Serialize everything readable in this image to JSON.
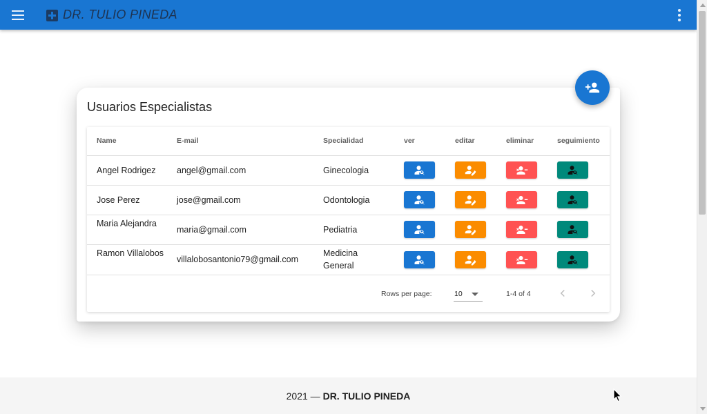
{
  "app": {
    "brand": "DR. TULIO PINEDA"
  },
  "card": {
    "title": "Usuarios Especialistas"
  },
  "table": {
    "headers": {
      "name": "Name",
      "email": "E-mail",
      "specialty": "Specialidad",
      "view": "ver",
      "edit": "editar",
      "delete": "eliminar",
      "followup": "seguimiento"
    },
    "rows": [
      {
        "name": "Angel Rodrigez",
        "email": "angel@gmail.com",
        "specialty": "Ginecologia"
      },
      {
        "name": "Jose Perez",
        "email": "jose@gmail.com",
        "specialty": "Odontologia"
      },
      {
        "name": "Maria Alejandra",
        "email": "maria@gmail.com",
        "specialty": "Pediatria"
      },
      {
        "name": "Ramon Villalobos",
        "email": "villalobosantonio79@gmail.com",
        "specialty": "Medicina General"
      }
    ]
  },
  "pagination": {
    "rows_per_page_label": "Rows per page:",
    "rows_per_page_value": "10",
    "range": "1-4 of 4"
  },
  "footer": {
    "year": "2021 —",
    "name": "DR. TULIO PINEDA"
  },
  "icons": {
    "menu": "menu-icon",
    "brand": "medical-cross-icon",
    "more": "more-vert-icon",
    "add_user": "person-add-icon",
    "view": "person-search-icon",
    "edit": "person-edit-icon",
    "delete": "person-remove-icon",
    "followup": "person-search-icon",
    "prev": "chevron-left-icon",
    "next": "chevron-right-icon"
  },
  "colors": {
    "primary": "#1976d2",
    "edit": "#fb8c00",
    "delete": "#ff5252",
    "followup": "#00897b",
    "footer_bg": "#f5f5f5"
  }
}
